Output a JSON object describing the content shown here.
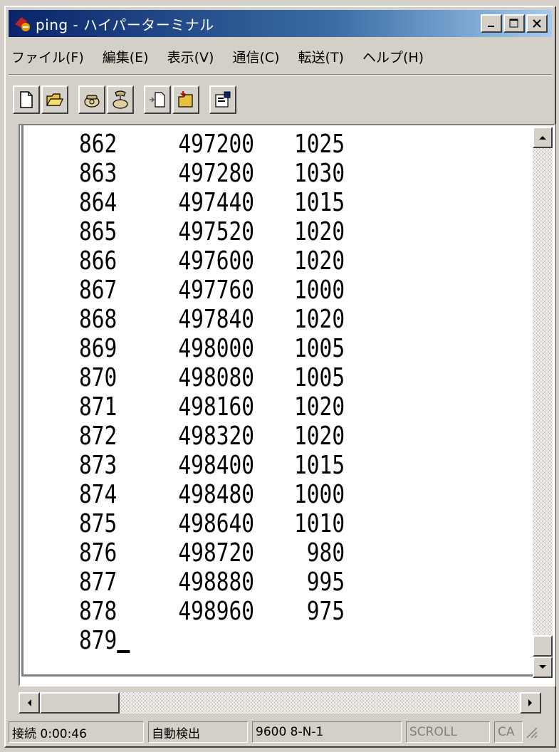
{
  "window": {
    "title": "ping - ハイパーターミナル",
    "icon": "hyperterminal-app-icon"
  },
  "menu": [
    {
      "label": "ファイル(F)"
    },
    {
      "label": "編集(E)"
    },
    {
      "label": "表示(V)"
    },
    {
      "label": "通信(C)"
    },
    {
      "label": "転送(T)"
    },
    {
      "label": "ヘルプ(H)"
    }
  ],
  "toolbar": [
    {
      "icon": "new-file-icon"
    },
    {
      "icon": "open-folder-icon"
    },
    {
      "icon": "connect-phone-icon"
    },
    {
      "icon": "disconnect-phone-icon"
    },
    {
      "icon": "send-file-icon"
    },
    {
      "icon": "receive-file-icon"
    },
    {
      "icon": "properties-icon"
    }
  ],
  "terminal": {
    "rows": [
      [
        "862",
        "497200",
        "1025"
      ],
      [
        "863",
        "497280",
        "1030"
      ],
      [
        "864",
        "497440",
        "1015"
      ],
      [
        "865",
        "497520",
        "1020"
      ],
      [
        "866",
        "497600",
        "1020"
      ],
      [
        "867",
        "497760",
        "1000"
      ],
      [
        "868",
        "497840",
        "1020"
      ],
      [
        "869",
        "498000",
        "1005"
      ],
      [
        "870",
        "498080",
        "1005"
      ],
      [
        "871",
        "498160",
        "1020"
      ],
      [
        "872",
        "498320",
        "1020"
      ],
      [
        "873",
        "498400",
        "1015"
      ],
      [
        "874",
        "498480",
        "1000"
      ],
      [
        "875",
        "498640",
        "1010"
      ],
      [
        "876",
        "498720",
        "980"
      ],
      [
        "877",
        "498880",
        "995"
      ],
      [
        "878",
        "498960",
        "975"
      ]
    ],
    "current_line": "879"
  },
  "status": {
    "connection": "接続 0:00:46",
    "detect": "自動検出",
    "port_settings": "9600 8-N-1",
    "scroll": "SCROLL",
    "caps": "CA"
  }
}
